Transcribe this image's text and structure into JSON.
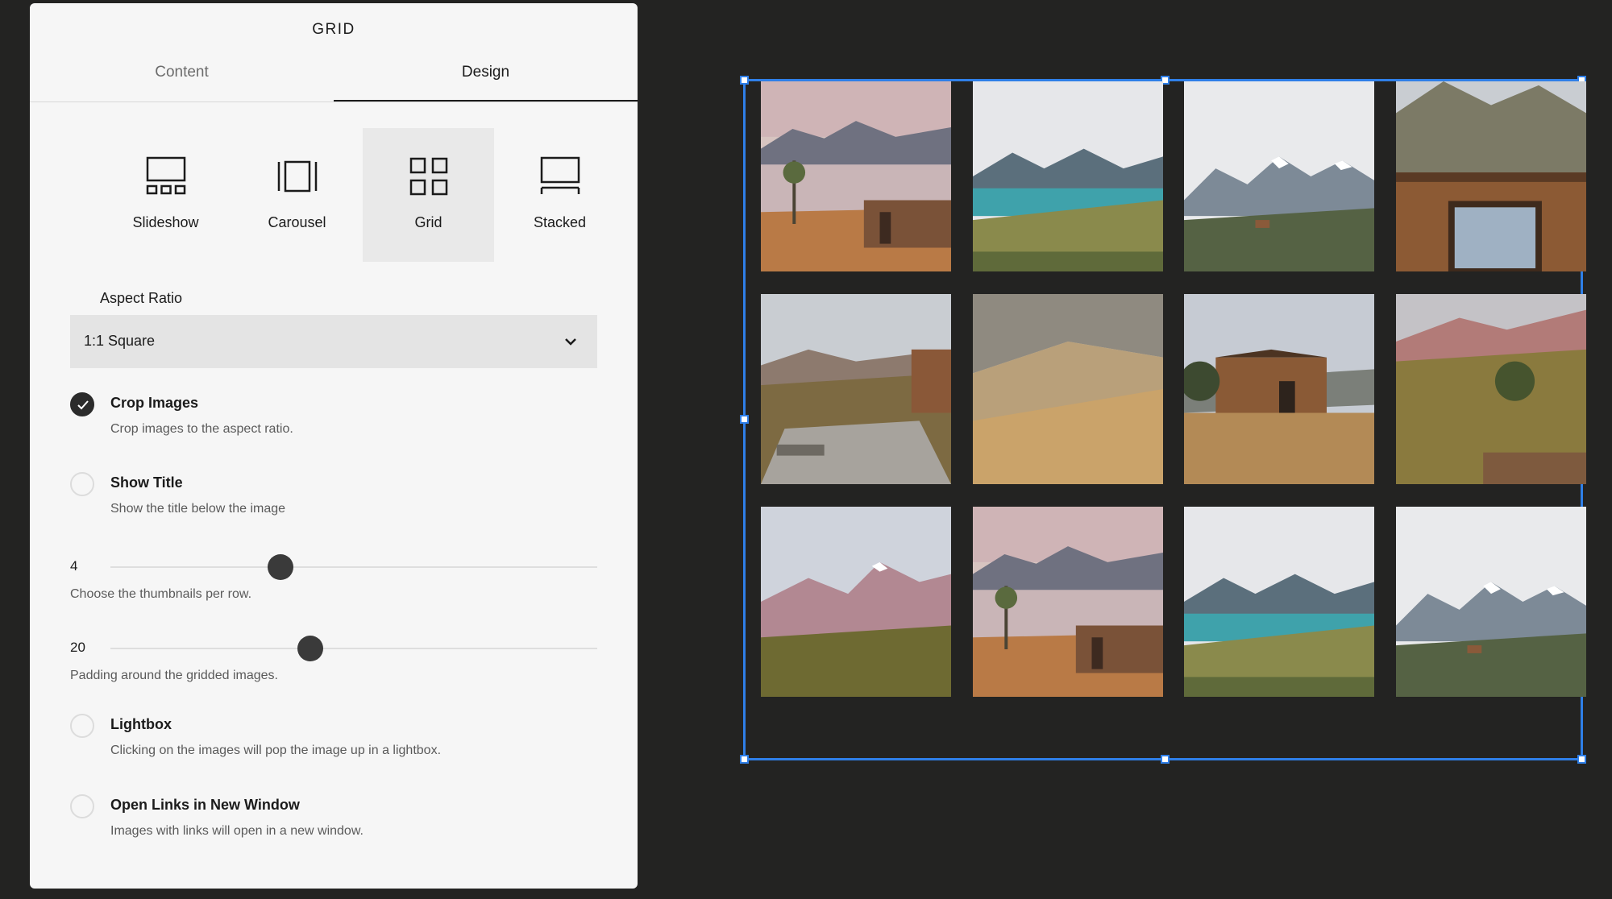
{
  "panel": {
    "title": "GRID",
    "tabs": [
      {
        "label": "Content",
        "active": false
      },
      {
        "label": "Design",
        "active": true
      }
    ],
    "layouts": [
      {
        "label": "Slideshow",
        "icon": "slideshow-icon",
        "selected": false
      },
      {
        "label": "Carousel",
        "icon": "carousel-icon",
        "selected": false
      },
      {
        "label": "Grid",
        "icon": "grid-icon",
        "selected": true
      },
      {
        "label": "Stacked",
        "icon": "stacked-icon",
        "selected": false
      }
    ],
    "aspect_ratio": {
      "label": "Aspect Ratio",
      "value": "1:1 Square",
      "icon": "chevron-down-icon"
    },
    "crop_images": {
      "title": "Crop Images",
      "description": "Crop images to the aspect ratio.",
      "checked": true
    },
    "show_title": {
      "title": "Show Title",
      "description": "Show the title below the image",
      "checked": false
    },
    "thumbnails_slider": {
      "value": "4",
      "description": "Choose the thumbnails per row.",
      "level": 0.35
    },
    "padding_slider": {
      "value": "20",
      "description": "Padding around the gridded images.",
      "level": 0.41
    },
    "lightbox": {
      "title": "Lightbox",
      "description": "Clicking on the images will pop the image up in a lightbox.",
      "checked": false
    },
    "open_links": {
      "title": "Open Links in New Window",
      "description": "Images with links will open in a new window.",
      "checked": false
    }
  },
  "gallery": {
    "selection_color": "#2f7fe8",
    "rows": 3,
    "columns": 4,
    "images": [
      "lake-cabin-photo",
      "turquoise-lake-photo",
      "snowy-peaks-photo",
      "cabin-window-photo",
      "cabin-stone-steps-photo",
      "grassy-hillside-photo",
      "wooden-cabin-photo",
      "hill-shrubs-photo",
      "pink-mountains-photo",
      "lake-cabin-photo",
      "turquoise-lake-photo",
      "snowy-peaks-photo"
    ]
  }
}
